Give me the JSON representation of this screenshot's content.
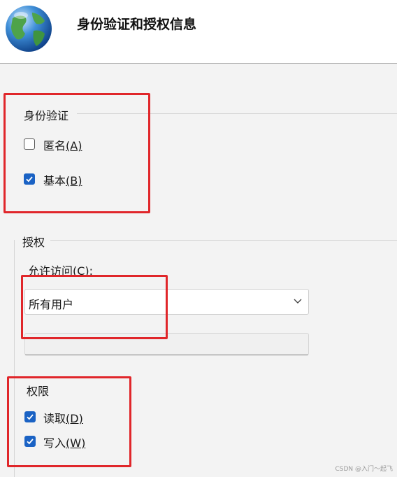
{
  "header": {
    "title": "身份验证和授权信息"
  },
  "auth": {
    "group_label": "身份验证",
    "anonymous_label": "匿名",
    "anonymous_key": "(A)",
    "anonymous_checked": false,
    "basic_label": "基本",
    "basic_key": "(B)",
    "basic_checked": true
  },
  "authorization": {
    "group_label": "授权",
    "allow_access_label": "允许访问(C):",
    "allow_access_value": "所有用户"
  },
  "permissions": {
    "group_label": "权限",
    "read_label": "读取",
    "read_key": "(D)",
    "read_checked": true,
    "write_label": "写入",
    "write_key": "(W)",
    "write_checked": true
  },
  "watermark": "CSDN @入门～起飞",
  "colors": {
    "checkbox_accent": "#1a62c4",
    "highlight_box": "#e0262a"
  },
  "icons": {
    "header_icon": "globe-icon",
    "dropdown": "chevron-down-icon",
    "check": "checkmark-icon"
  }
}
